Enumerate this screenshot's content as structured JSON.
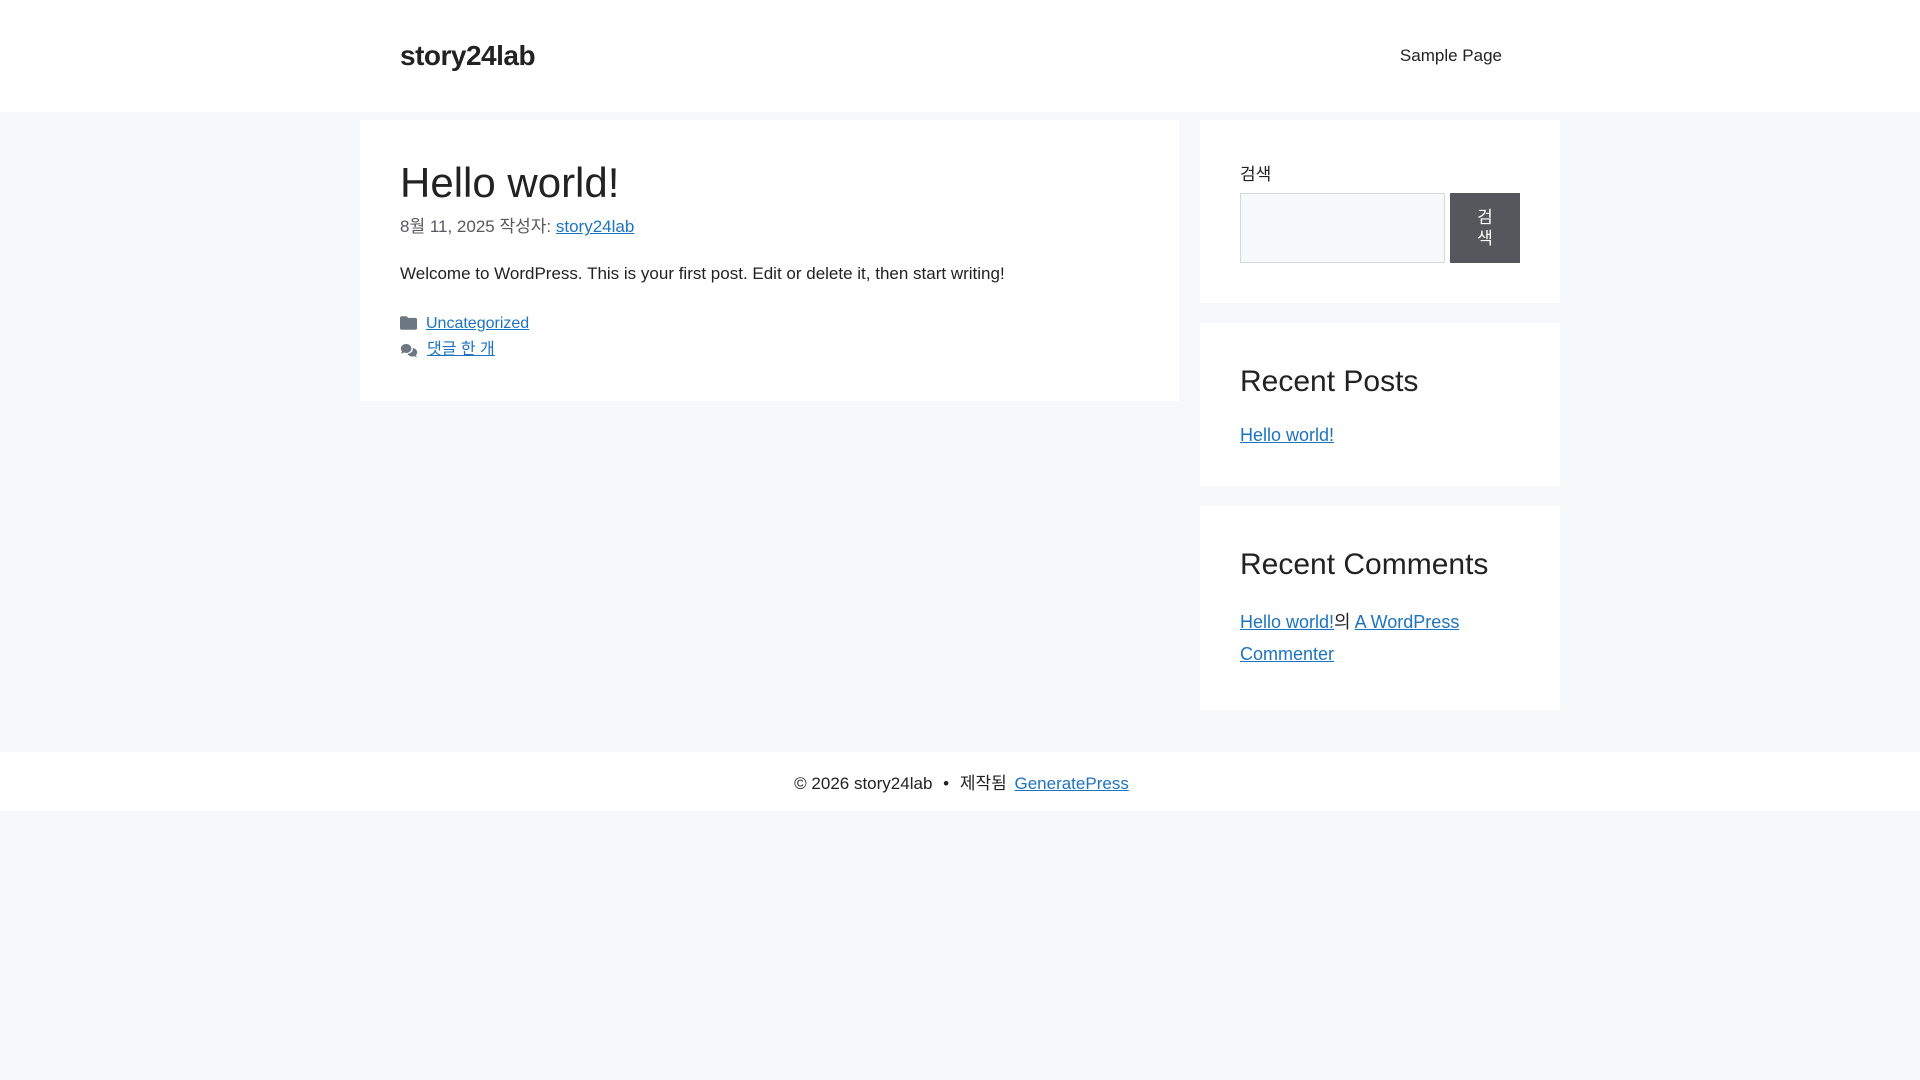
{
  "site": {
    "title": "story24lab",
    "nav": [
      {
        "label": "Sample Page"
      }
    ]
  },
  "post": {
    "title": "Hello world!",
    "date": "8월 11, 2025",
    "byline_label": "작성자:",
    "author": "story24lab",
    "body": "Welcome to WordPress. This is your first post. Edit or delete it, then start writing!",
    "category": "Uncategorized",
    "comments_link": "댓글 한 개"
  },
  "sidebar": {
    "search": {
      "label": "검색",
      "button_label": "검색",
      "input_value": "",
      "input_placeholder": ""
    },
    "recent_posts": {
      "title": "Recent Posts",
      "items": [
        "Hello world!"
      ]
    },
    "recent_comments": {
      "title": "Recent Comments",
      "items": [
        {
          "post": "Hello world!",
          "connector": "의",
          "commenter": "A WordPress Commenter"
        }
      ]
    }
  },
  "footer": {
    "copyright": "© 2026 story24lab",
    "separator": "•",
    "built_label": "제작됨",
    "builder_link": "GeneratePress"
  },
  "colors": {
    "page_bg": "#f7f8f9",
    "surface": "#ffffff",
    "text": "#222222",
    "meta_text": "#575760",
    "accent_link": "#1e73be",
    "button_bg": "#55575d",
    "icon_gray": "#6c7781"
  }
}
